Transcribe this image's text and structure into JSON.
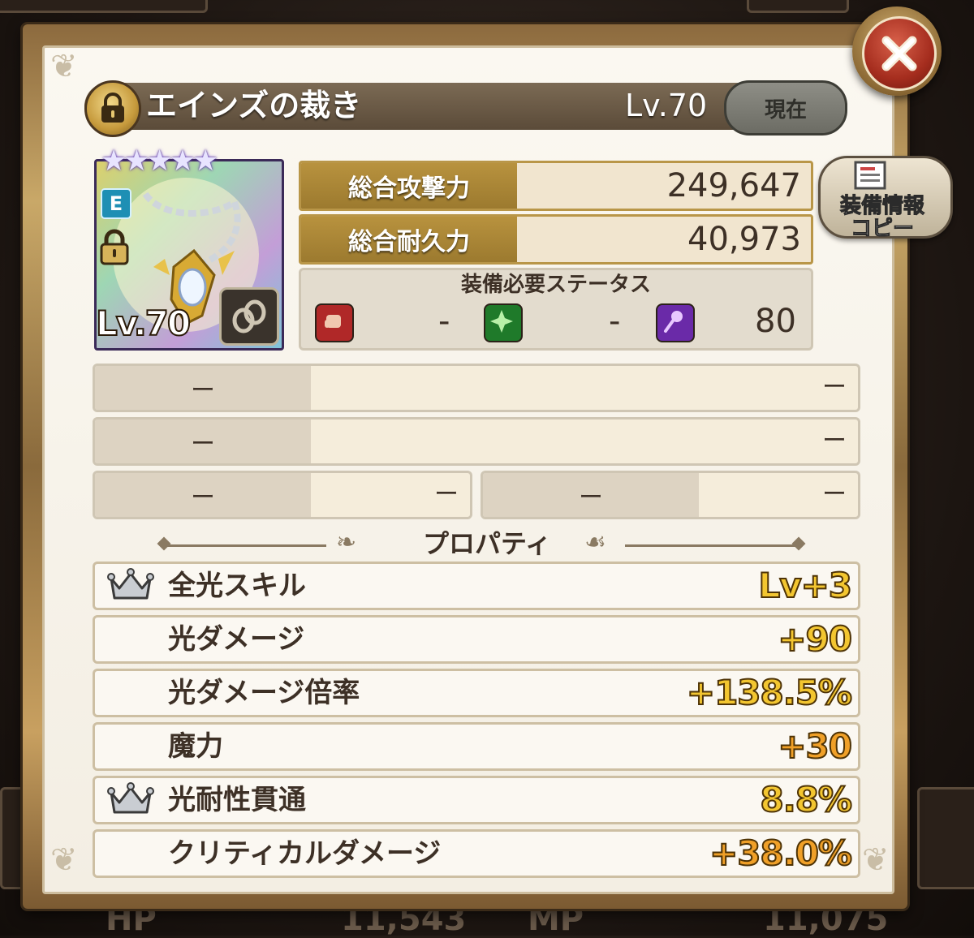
{
  "item": {
    "name": "エインズの裁き",
    "level_label": "Lv.70",
    "status_button": "現在",
    "card_level": "Lv.70",
    "card_grade_badge": "E",
    "stars": 5,
    "locked": true
  },
  "stats": {
    "attack_label": "総合攻撃力",
    "attack_value": "249,647",
    "durability_label": "総合耐久力",
    "durability_value": "40,973"
  },
  "copy_button": {
    "line1": "装備情報",
    "line2": "コピー"
  },
  "requirements": {
    "title": "装備必要ステータス",
    "strength": "-",
    "dexterity": "-",
    "intelligence": "80"
  },
  "slots": {
    "row1_left": "ー",
    "row1_right": "ー",
    "row2_left": "ー",
    "row2_right": "ー",
    "row3a_left": "ー",
    "row3a_right": "ー",
    "row3b_left": "ー",
    "row3b_right": "ー"
  },
  "properties_title": "プロパティ",
  "properties": [
    {
      "name": "全光スキル",
      "value": "Lv+3",
      "crown": true
    },
    {
      "name": "光ダメージ",
      "value": "+90",
      "crown": false
    },
    {
      "name": "光ダメージ倍率",
      "value": "+138.5%",
      "crown": false
    },
    {
      "name": "魔力",
      "value": "+30",
      "crown": false
    },
    {
      "name": "光耐性貫通",
      "value": "8.8%",
      "crown": true
    },
    {
      "name": "クリティカルダメージ",
      "value": "+38.0%",
      "crown": false
    }
  ],
  "background": {
    "hp_label": "HP",
    "hp_value": "11,543",
    "mp_label": "MP",
    "mp_value": "11,075"
  },
  "colors": {
    "gold_value": "#f3c630",
    "orange_value": "#f0a028",
    "stat_label_gold": "#b08a38",
    "close_red": "#b2321f"
  }
}
